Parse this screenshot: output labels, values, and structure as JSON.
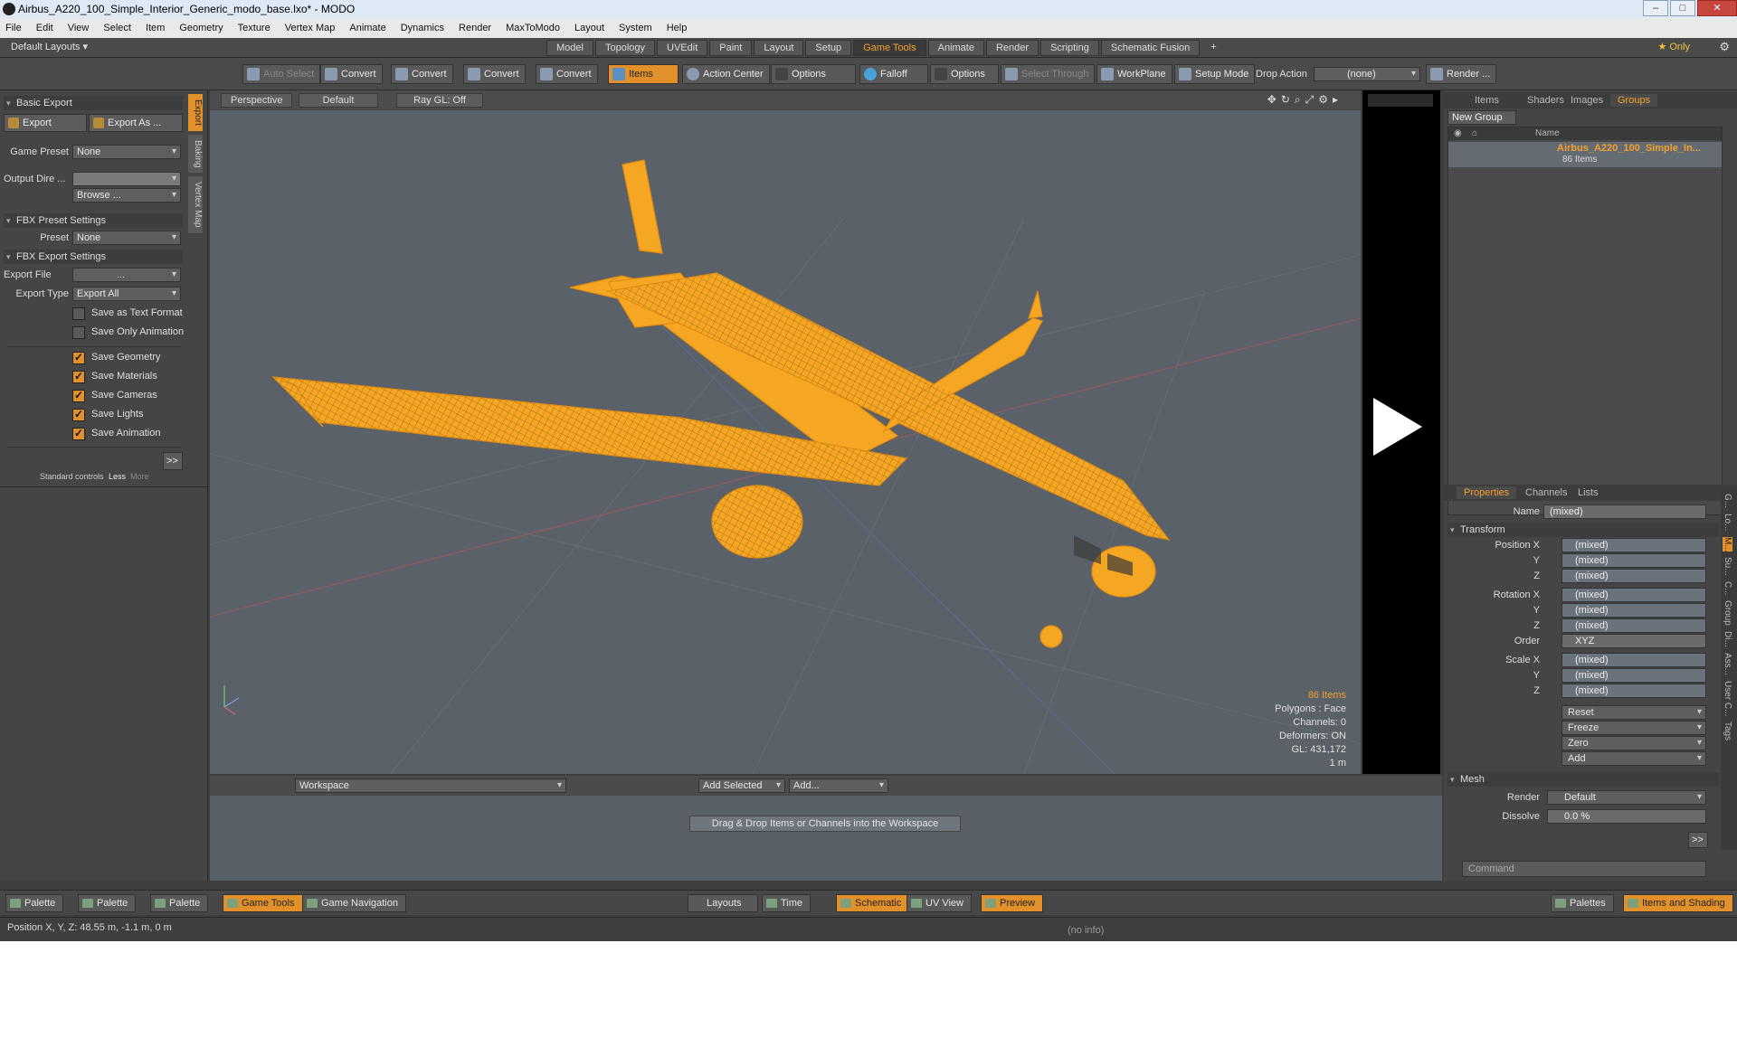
{
  "window": {
    "title": "Airbus_A220_100_Simple_Interior_Generic_modo_base.lxo* - MODO",
    "minimize": "–",
    "maximize": "□",
    "close": "✕"
  },
  "menu": [
    "File",
    "Edit",
    "View",
    "Select",
    "Item",
    "Geometry",
    "Texture",
    "Vertex Map",
    "Animate",
    "Dynamics",
    "Render",
    "MaxToModo",
    "Layout",
    "System",
    "Help"
  ],
  "layoutbar": {
    "default_layouts": "Default Layouts ▾",
    "tabs": [
      "Model",
      "Topology",
      "UVEdit",
      "Paint",
      "Layout",
      "Setup",
      "Game Tools",
      "Animate",
      "Render",
      "Scripting",
      "Schematic Fusion"
    ],
    "active_tab": "Game Tools",
    "plus": "+",
    "only": "★ Only"
  },
  "toolbar": {
    "auto_select": "Auto Select",
    "convert1": "Convert",
    "convert2": "Convert",
    "convert3": "Convert",
    "convert4": "Convert",
    "items": "Items",
    "action_center": "Action Center",
    "options1": "Options",
    "falloff": "Falloff",
    "options2": "Options",
    "select_through": "Select Through",
    "workplane": "WorkPlane",
    "setup_mode": "Setup Mode",
    "drop_action": "Drop Action",
    "drop_value": "(none)",
    "render": "Render ..."
  },
  "left": {
    "vtabs": [
      "Export",
      "Baking",
      "Vertex Map"
    ],
    "basic_export": "Basic Export",
    "export": "Export",
    "export_as": "Export As ...",
    "game_preset_label": "Game Preset",
    "game_preset_value": "None",
    "output_dir_label": "Output Dire ...",
    "browse": "Browse ...",
    "fbx_preset_settings": "FBX Preset Settings",
    "preset_label": "Preset",
    "preset_value": "None",
    "fbx_export_settings": "FBX Export Settings",
    "export_file_label": "Export File",
    "export_file_value": "...",
    "export_type_label": "Export Type",
    "export_type_value": "Export All",
    "checks": [
      {
        "label": "Save as Text Format",
        "on": false
      },
      {
        "label": "Save Only Animation",
        "on": false
      },
      {
        "label": "Save Geometry",
        "on": true
      },
      {
        "label": "Save Materials",
        "on": true
      },
      {
        "label": "Save Cameras",
        "on": true
      },
      {
        "label": "Save Lights",
        "on": true
      },
      {
        "label": "Save Animation",
        "on": true
      }
    ],
    "more_btn": ">>",
    "standard_controls": "Standard controls",
    "less": "Less",
    "more": "More"
  },
  "viewport": {
    "perspective": "Perspective",
    "default": "Default",
    "raygl": "Ray GL: Off",
    "stats": {
      "items": "86 Items",
      "polygons": "Polygons : Face",
      "channels": "Channels: 0",
      "deformers": "Deformers: ON",
      "gl": "GL: 431,172",
      "scale": "1 m"
    }
  },
  "workspace": {
    "name": "Workspace",
    "add_selected": "Add Selected",
    "add": "Add...",
    "drag_msg": "Drag & Drop Items or Channels into the Workspace"
  },
  "right": {
    "top_tabs": [
      "Items",
      "Shaders",
      "Images",
      "Groups"
    ],
    "active_top": "Groups",
    "new_group": "New Group",
    "col_name": "Name",
    "group_name": "Airbus_A220_100_Simple_In...",
    "group_count": "86 Items",
    "prop_tabs": [
      "Properties",
      "Channels",
      "Lists"
    ],
    "name_label": "Name",
    "name_value": "(mixed)",
    "transform": "Transform",
    "rows": [
      {
        "label": "Position X",
        "value": "(mixed)"
      },
      {
        "label": "Y",
        "value": "(mixed)"
      },
      {
        "label": "Z",
        "value": "(mixed)"
      },
      {
        "label": "Rotation X",
        "value": "(mixed)"
      },
      {
        "label": "Y",
        "value": "(mixed)"
      },
      {
        "label": "Z",
        "value": "(mixed)"
      },
      {
        "label": "Order",
        "value": "XYZ"
      },
      {
        "label": "Scale X",
        "value": "(mixed)"
      },
      {
        "label": "Y",
        "value": "(mixed)"
      },
      {
        "label": "Z",
        "value": "(mixed)"
      }
    ],
    "actions": [
      "Reset",
      "Freeze",
      "Zero",
      "Add"
    ],
    "mesh": "Mesh",
    "render_label": "Render",
    "render_value": "Default",
    "dissolve_label": "Dissolve",
    "dissolve_value": "0.0 %",
    "more_btn": ">>",
    "command": "Command",
    "side_tabs": [
      "G...",
      "Lo...",
      "M...",
      "Su...",
      "C...",
      "Group",
      "Di...",
      "Ass...",
      "User C...",
      "Tags"
    ]
  },
  "bottom": {
    "left": [
      "Palette",
      "Palette",
      "Palette",
      "Game Tools",
      "Game Navigation"
    ],
    "left_active": "Game Tools",
    "center": [
      "Layouts",
      "Time",
      "Schematic",
      "UV View",
      "Preview"
    ],
    "center_active": [
      "Schematic",
      "Preview"
    ],
    "right": [
      "Palettes",
      "Items and Shading"
    ],
    "right_active": "Items and Shading"
  },
  "status": {
    "position": "Position X, Y, Z:  48.55 m, -1.1 m, 0 m",
    "info": "(no info)"
  },
  "colors": {
    "accent": "#e2912a",
    "wire": "#f5a623",
    "viewport_bg": "#5a6168"
  }
}
